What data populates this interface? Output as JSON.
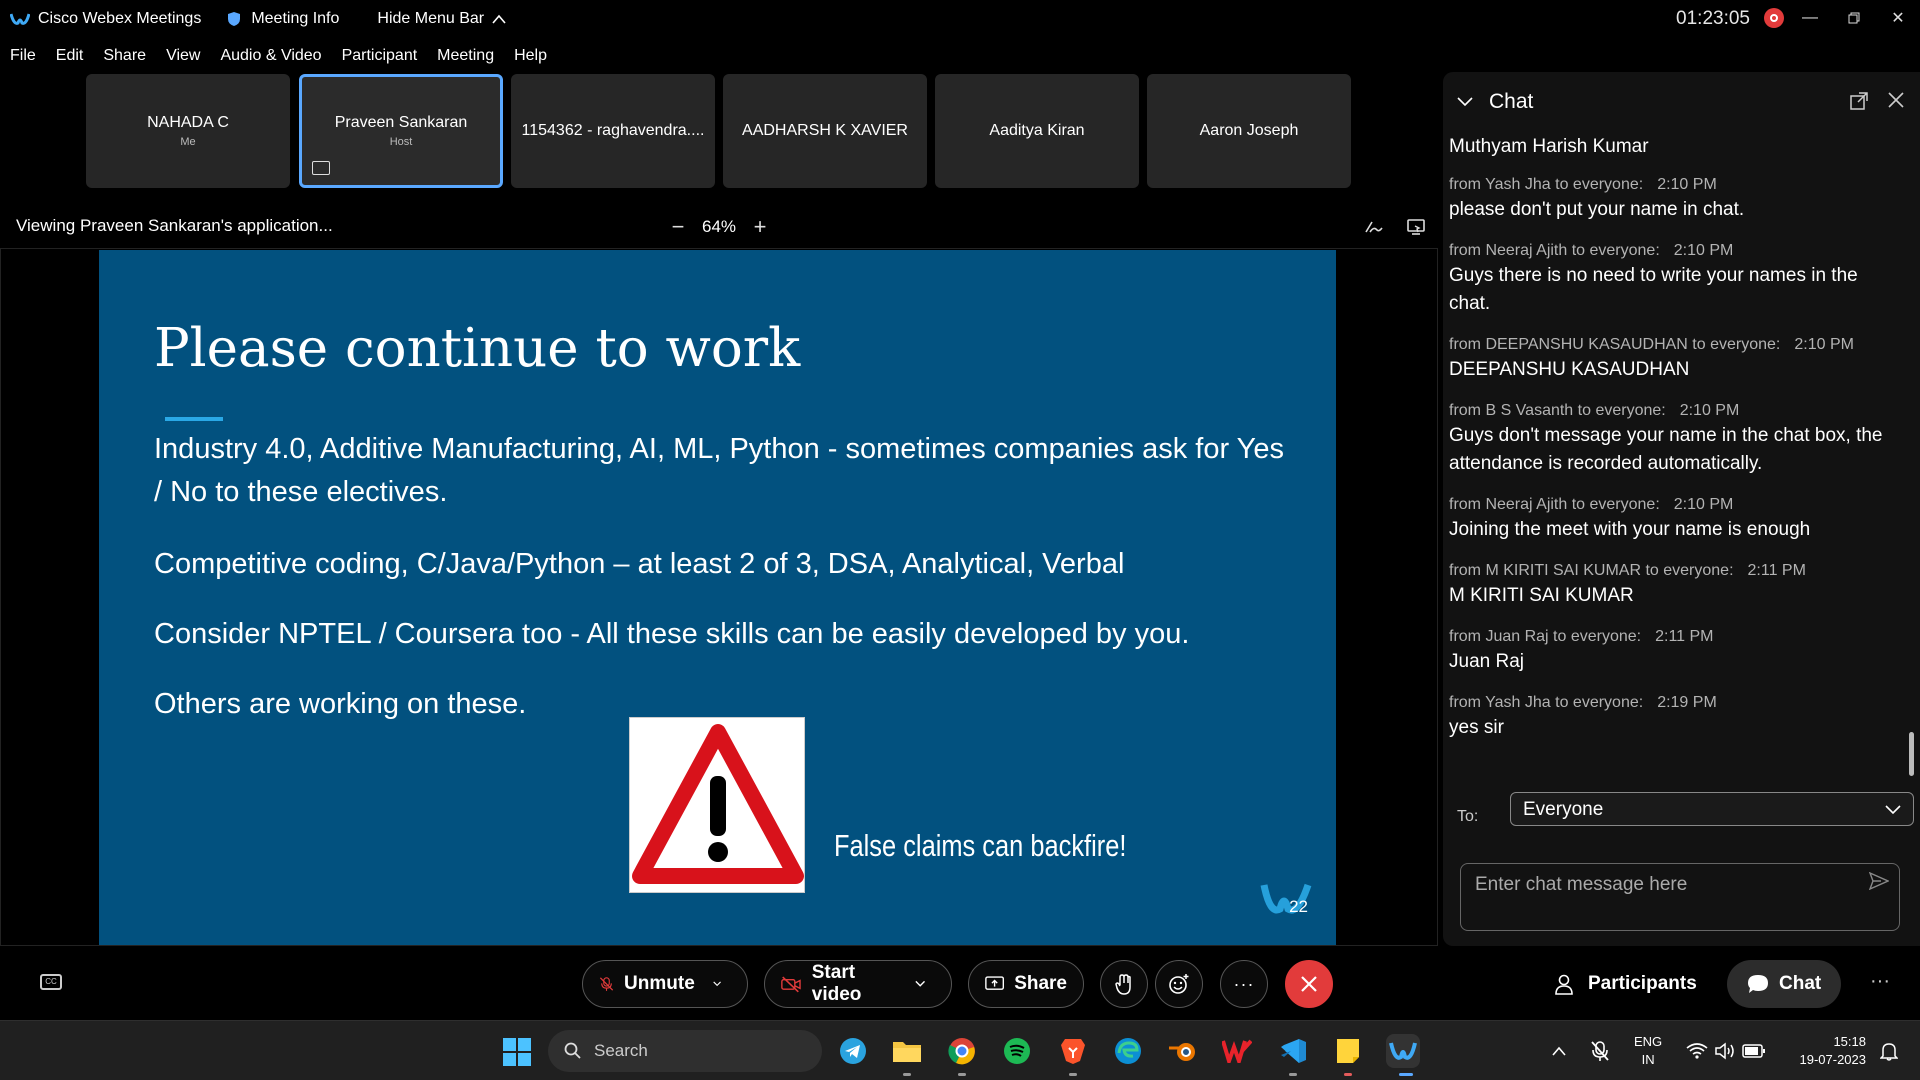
{
  "titlebar": {
    "app_name": "Cisco Webex Meetings",
    "meeting_info": "Meeting Info",
    "hide_menu": "Hide Menu Bar",
    "timer": "01:23:05"
  },
  "menu": [
    "File",
    "Edit",
    "Share",
    "View",
    "Audio & Video",
    "Participant",
    "Meeting",
    "Help"
  ],
  "participants": [
    {
      "name": "NAHADA C",
      "role": "Me"
    },
    {
      "name": "Praveen Sankaran",
      "role": "Host"
    },
    {
      "name": "1154362 - raghavendra....",
      "role": ""
    },
    {
      "name": "AADHARSH K XAVIER",
      "role": ""
    },
    {
      "name": "Aaditya Kiran",
      "role": ""
    },
    {
      "name": "Aaron Joseph",
      "role": ""
    }
  ],
  "viewing": {
    "text": "Viewing Praveen Sankaran's application...",
    "zoom": "64%"
  },
  "slide": {
    "title": "Please continue to work",
    "lines": [
      "Industry 4.0, Additive Manufacturing, AI, ML, Python - sometimes companies ask for Yes / No  to these electives.",
      "Competitive coding, C/Java/Python – at least 2 of 3, DSA, Analytical, Verbal",
      "Consider NPTEL / Coursera too - All these skills can be easily developed by you.",
      "Others are working on these."
    ],
    "claim": "False claims can backfire!",
    "page_number": "22"
  },
  "chat": {
    "title": "Chat",
    "first_line": "Muthyam Harish Kumar",
    "messages": [
      {
        "meta": "from Yash Jha to everyone:",
        "time": "2:10 PM",
        "body": "please don't put your name in chat."
      },
      {
        "meta": "from Neeraj Ajith to everyone:",
        "time": "2:10 PM",
        "body": "Guys there is no need to write your names in the chat."
      },
      {
        "meta": "from DEEPANSHU KASAUDHAN to everyone:",
        "time": "2:10 PM",
        "body": "DEEPANSHU KASAUDHAN"
      },
      {
        "meta": "from B S Vasanth to everyone:",
        "time": "2:10 PM",
        "body": "Guys don't message your name in the chat box, the attendance is recorded automatically."
      },
      {
        "meta": "from Neeraj Ajith to everyone:",
        "time": "2:10 PM",
        "body": "Joining the meet with your name is enough"
      },
      {
        "meta": "from M KIRITI SAI KUMAR to everyone:",
        "time": "2:11 PM",
        "body": "M KIRITI SAI KUMAR"
      },
      {
        "meta": "from Juan Raj to everyone:",
        "time": "2:11 PM",
        "body": "Juan Raj"
      },
      {
        "meta": "from Yash Jha to everyone:",
        "time": "2:19 PM",
        "body": "yes sir"
      }
    ],
    "to_label": "To:",
    "to_value": "Everyone",
    "input_placeholder": "Enter chat message here"
  },
  "controls": {
    "unmute": "Unmute",
    "start_video": "Start video",
    "share": "Share",
    "participants": "Participants",
    "chat": "Chat"
  },
  "taskbar": {
    "search": "Search",
    "lang_1": "ENG",
    "lang_2": "IN",
    "time": "15:18",
    "date": "19-07-2023"
  },
  "colors": {
    "slide_bg": "#02517f",
    "accent_blue": "#5aa8ff",
    "end_red": "#e23b3b"
  }
}
